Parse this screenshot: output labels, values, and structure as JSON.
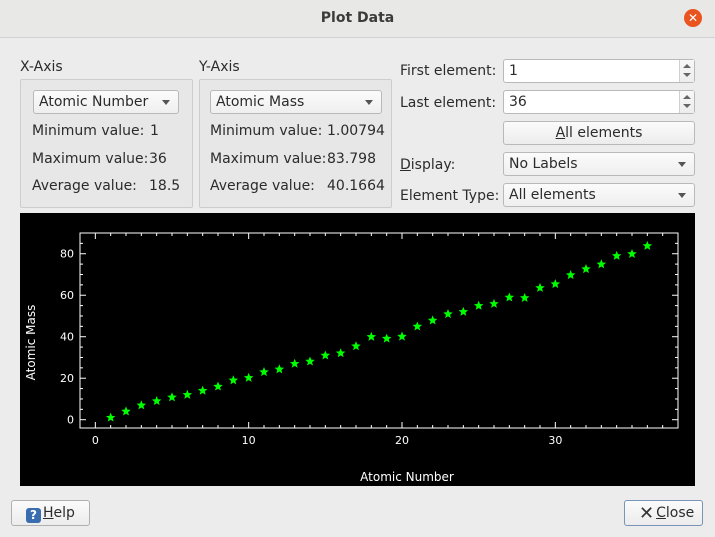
{
  "window": {
    "title": "Plot Data",
    "close_icon": "close-icon"
  },
  "x_axis_group": {
    "title": "X-Axis",
    "selected": "Atomic Number",
    "min_label": "Minimum value:",
    "min_value": "1",
    "max_label": "Maximum value:",
    "max_value": "36",
    "avg_label": "Average value:",
    "avg_value": "18.5"
  },
  "y_axis_group": {
    "title": "Y-Axis",
    "selected": "Atomic Mass",
    "min_label": "Minimum value:",
    "min_value": "1.00794",
    "max_label": "Maximum value:",
    "max_value": "83.798",
    "avg_label": "Average value:",
    "avg_value": "40.1664"
  },
  "range": {
    "first_label": "First element:",
    "first_value": "1",
    "last_label": "Last element:",
    "last_value": "36",
    "all_button_prefix": "",
    "all_button_mnemonic": "A",
    "all_button_rest": "ll elements"
  },
  "display": {
    "label_mnemonic": "D",
    "label_rest": "isplay:",
    "selected": "No Labels"
  },
  "element_type": {
    "label": "Element Type:",
    "selected": "All elements"
  },
  "footer": {
    "help_mnemonic": "H",
    "help_rest": "elp",
    "help_icon": "help-icon",
    "close_mnemonic": "C",
    "close_rest": "lose",
    "close_icon": "close-icon"
  },
  "colors": {
    "plot_bg": "#000000",
    "marker": "#00ff00",
    "axis": "#ffffff"
  },
  "chart_data": {
    "type": "scatter",
    "xlabel": "Atomic Number",
    "ylabel": "Atomic Mass",
    "xlim": [
      -1,
      38
    ],
    "ylim": [
      -4,
      90
    ],
    "xticks": [
      0,
      10,
      20,
      30
    ],
    "yticks": [
      0,
      20,
      40,
      60,
      80
    ],
    "marker": "star",
    "x": [
      1,
      2,
      3,
      4,
      5,
      6,
      7,
      8,
      9,
      10,
      11,
      12,
      13,
      14,
      15,
      16,
      17,
      18,
      19,
      20,
      21,
      22,
      23,
      24,
      25,
      26,
      27,
      28,
      29,
      30,
      31,
      32,
      33,
      34,
      35,
      36
    ],
    "y": [
      1.008,
      4.003,
      6.94,
      9.012,
      10.81,
      12.011,
      14.007,
      15.999,
      18.998,
      20.18,
      22.99,
      24.305,
      26.982,
      28.085,
      30.974,
      32.06,
      35.45,
      39.948,
      39.098,
      40.078,
      44.956,
      47.867,
      50.942,
      51.996,
      54.938,
      55.845,
      58.933,
      58.693,
      63.546,
      65.38,
      69.723,
      72.63,
      74.922,
      78.971,
      79.904,
      83.798
    ]
  }
}
